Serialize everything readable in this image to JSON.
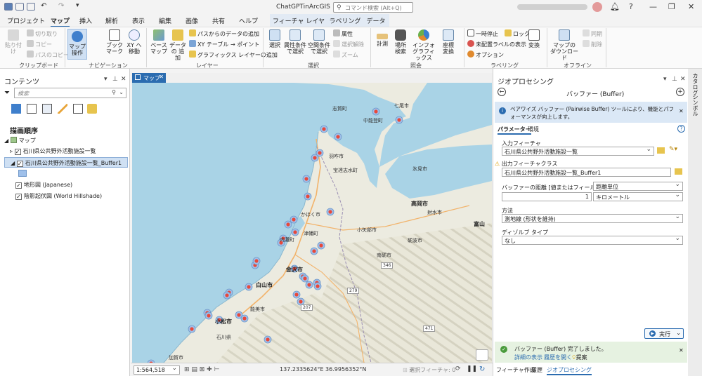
{
  "window": {
    "title": "ChatGPTinArcGIS",
    "command_search_placeholder": "コマンド検索 (Alt+Q)"
  },
  "tabs": [
    "プロジェクト",
    "マップ",
    "挿入",
    "解析",
    "表示",
    "編集",
    "画像",
    "共有",
    "ヘルプ"
  ],
  "active_tab": "マップ",
  "context_tabs": [
    "フィーチャ レイヤー",
    "ラベリング",
    "データ"
  ],
  "ribbon": {
    "clipboard": {
      "label": "クリップボード",
      "paste": "貼り付け",
      "cut": "切り取り",
      "copy": "コピー",
      "copy_path": "パスのコピー"
    },
    "navigation": {
      "label": "ナビゲーション",
      "explore": "マップ操作",
      "bookmark": "ブック マーク",
      "goto_xy": "XY へ移動"
    },
    "layer": {
      "label": "レイヤー",
      "basemap": "ベース マップ",
      "add_data": "データの 追加",
      "add_from_path": "パスからのデータの追加",
      "xy_to_point": "XY テーブル → ポイント",
      "add_graphics": "グラフィックス レイヤーの追加"
    },
    "selection": {
      "label": "選択",
      "select": "選択",
      "by_attr": "属性条件 で選択",
      "by_location": "空間条件 で選択",
      "attributes": "属性",
      "clear": "選択解除",
      "zoom": "ズーム"
    },
    "inquiry": {
      "label": "照会",
      "measure": "計測",
      "locate": "場所 検索",
      "infographics": "インフォ グラフィックス",
      "convert": "座標 変換"
    },
    "labeling": {
      "label": "ラベリング",
      "pause": "一時停止",
      "lock": "ロック",
      "unplaced": "未配置ラベルの表示",
      "options": "オプション",
      "convert": "変換"
    },
    "offline": {
      "label": "オフライン",
      "download_map": "マップの ダウンロード",
      "sync": "同期",
      "remove": "削除"
    }
  },
  "contents": {
    "title": "コンテンツ",
    "search_placeholder": "検索",
    "drawing_order": "描画順序",
    "items": [
      {
        "label": "マップ",
        "checked": false,
        "level": 0
      },
      {
        "label": "石川県公共野外活動施設一覧",
        "checked": true,
        "level": 1
      },
      {
        "label": "石川県公共野外活動施設一覧_Buffer1",
        "checked": true,
        "level": 1
      },
      {
        "label": "地形図 (Japanese)",
        "checked": true,
        "level": 1
      },
      {
        "label": "陰影起伏図 (World Hillshade)",
        "checked": true,
        "level": 1
      }
    ]
  },
  "map": {
    "tab": "マップ",
    "cities": [
      {
        "name": "七尾市",
        "major": false
      },
      {
        "name": "志賀町",
        "major": false
      },
      {
        "name": "中能登町",
        "major": false
      },
      {
        "name": "羽咋市",
        "major": false
      },
      {
        "name": "宝達志水町",
        "major": false
      },
      {
        "name": "氷見市",
        "major": false
      },
      {
        "name": "高岡市",
        "major": true
      },
      {
        "name": "射水市",
        "major": false
      },
      {
        "name": "かほく市",
        "major": false
      },
      {
        "name": "津幡町",
        "major": false
      },
      {
        "name": "小矢部市",
        "major": false
      },
      {
        "name": "富山",
        "major": true
      },
      {
        "name": "砺波市",
        "major": false
      },
      {
        "name": "内灘町",
        "major": false
      },
      {
        "name": "南砺市",
        "major": false
      },
      {
        "name": "金沢市",
        "major": true
      },
      {
        "name": "白山市",
        "major": true
      },
      {
        "name": "能美市",
        "major": false
      },
      {
        "name": "小松市",
        "major": true
      },
      {
        "name": "石川県",
        "major": false
      },
      {
        "name": "加賀市",
        "major": false
      }
    ],
    "roads": [
      "346",
      "279",
      "207",
      "471"
    ],
    "scale": "1:564,518",
    "coords": "137.2335624°E 36.9956352°N",
    "selected_features": "選択フィーチャ: 0"
  },
  "geoprocessing": {
    "title": "ジオプロセシング",
    "tool_title": "バッファー (Buffer)",
    "info": "ペアワイズ バッファー (Pairwise Buffer) ツールにより、機能とパフォーマンスが向上します。",
    "tab_params": "パラメーター",
    "tab_env": "環境",
    "input_label": "入力フィーチャ",
    "input_value": "石川県公共野外活動施設一覧",
    "output_label": "出力フィーチャクラス",
    "output_value": "石川県公共野外活動施設一覧_Buffer1",
    "distance_label": "バッファーの距離 [値またはフィールド]",
    "distance_type": "距離単位",
    "distance_value": "1",
    "distance_unit": "キロメートル",
    "method_label": "方法",
    "method_value": "測地線 (形状を維持)",
    "dissolve_label": "ディゾルブ タイプ",
    "dissolve_value": "なし",
    "run": "実行",
    "done_msg": "バッファー (Buffer) 完了しました。",
    "details": "詳細の表示",
    "open_history": "履歴を開く",
    "suggest": "提案",
    "bottom_tabs": [
      "フィーチャ作成",
      "履歴",
      "ジオプロセシング"
    ]
  },
  "side_tabs": [
    "カタログ",
    "シンボル"
  ],
  "colors": {
    "accent": "#2b6cb0",
    "buffer": "#e8483a",
    "water": "#a9d3e6",
    "land": "#ececdf"
  }
}
